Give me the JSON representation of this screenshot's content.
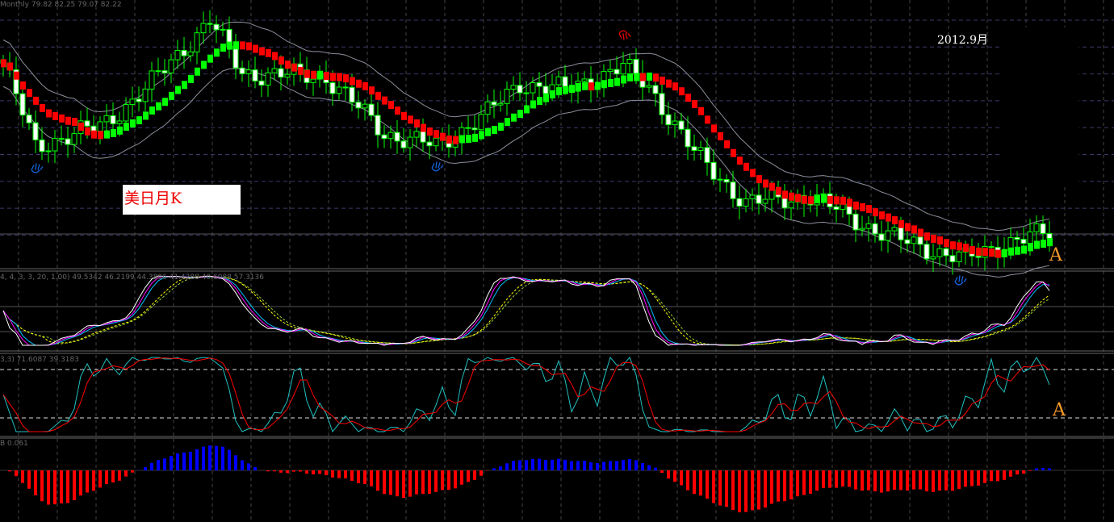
{
  "header": {
    "main_legend": "Monthly  79.82 82.25 79.07 82.22",
    "osc1_legend": "4, 4, 3, 3, 20, 1.00) 49.5342 46.2199 44.3806 41.4288 40.6088 57.3136",
    "osc2_legend": "3,3) 71.6087 39.3183",
    "hist_legend": "B 0.061"
  },
  "annotations": {
    "title_box": "美日月K",
    "date": "2012.9月",
    "marker_main": "A",
    "marker_osc": "A"
  },
  "colors": {
    "bull": "#00ff00",
    "bear": "#ffffff",
    "trend_up": "#00ff00",
    "trend_down": "#ff0000",
    "hist_pos": "#0000ff",
    "hist_neg": "#ff0000",
    "grid": "#3a3a6a"
  },
  "chart_data": {
    "type": "candlestick",
    "timeframe": "Monthly",
    "ylim": [
      70,
      150
    ],
    "candle_count": 163,
    "close_keypoints": [
      [
        0,
        131
      ],
      [
        5,
        106
      ],
      [
        8,
        108
      ],
      [
        15,
        112
      ],
      [
        22,
        123
      ],
      [
        32,
        144
      ],
      [
        37,
        128
      ],
      [
        50,
        127
      ],
      [
        59,
        110
      ],
      [
        67,
        106
      ],
      [
        75,
        116
      ],
      [
        80,
        125
      ],
      [
        87,
        123
      ],
      [
        96,
        130
      ],
      [
        100,
        124
      ],
      [
        107,
        104
      ],
      [
        115,
        89
      ],
      [
        125,
        91
      ],
      [
        137,
        79
      ],
      [
        149,
        72
      ],
      [
        155,
        77
      ],
      [
        162,
        80
      ]
    ],
    "last_bar": {
      "open": 79.82,
      "high": 82.25,
      "low": 79.07,
      "close": 82.22
    },
    "indicators": [
      {
        "name": "moving-average-envelope",
        "pane": "main"
      },
      {
        "name": "trend-blocks",
        "pane": "main"
      },
      {
        "name": "multi-stochastic",
        "pane": "osc1",
        "levels": [
          30,
          70
        ]
      },
      {
        "name": "stochastic",
        "pane": "osc2",
        "levels": [
          20,
          80
        ]
      },
      {
        "name": "histogram",
        "pane": "hist",
        "zero": 0
      }
    ]
  }
}
